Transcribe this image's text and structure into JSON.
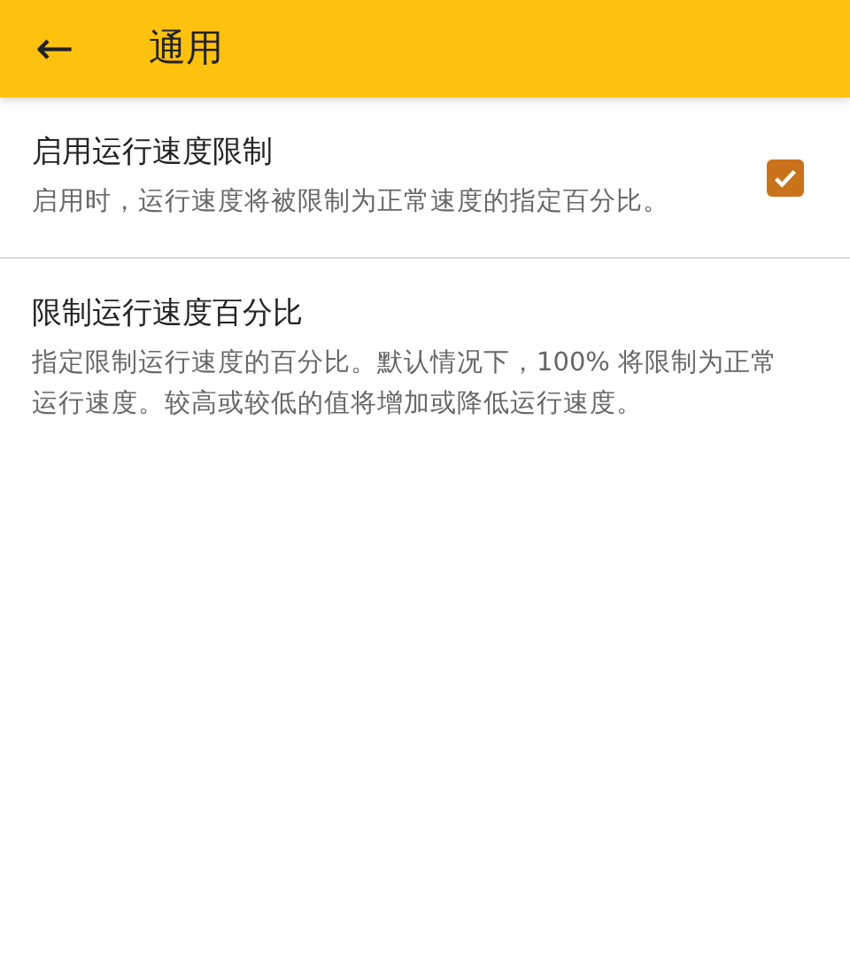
{
  "app_bar": {
    "back_icon": "←",
    "title": "通用"
  },
  "settings": [
    {
      "kind": "checkbox",
      "title": "启用运行速度限制",
      "summary": "启用时，运行速度将被限制为正常速度的指定百分比。",
      "checked": true
    },
    {
      "kind": "text",
      "title": "限制运行速度百分比",
      "summary": "指定限制运行速度的百分比。默认情况下，100% 将限制为正常运行速度。较高或较低的值将增加或降低运行速度。"
    }
  ]
}
